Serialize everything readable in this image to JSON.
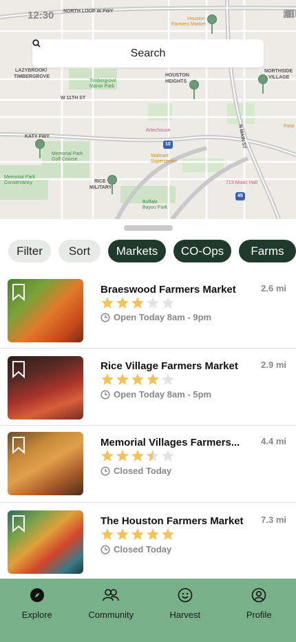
{
  "status": {
    "time": "12:30"
  },
  "map": {
    "labels": {
      "north_loop": "NORTH LOOP W FWY",
      "lazybrook": "LAZYBROOK/",
      "timbergrove": "TIMBERGROVE",
      "houston_heights_1": "HOUSTON",
      "houston_heights_2": "HEIGHTS",
      "northside_1": "NORTHSIDE",
      "northside_2": "VILLAGE",
      "w11th": "W 11TH ST",
      "katy": "KATY FWY",
      "rice_1": "RICE",
      "rice_2": "MILITARY",
      "n_main": "N MAIN ST"
    },
    "pois": {
      "houston_fm_1": "Houston",
      "houston_fm_2": "Farmers Market",
      "timbergrove_park_1": "Timbergrove",
      "timbergrove_park_2": "Manor Park",
      "artechouse": "Artechouse",
      "walmart_1": "Walmart",
      "walmart_2": "Supercenter",
      "memorial_golf_1": "Memorial Park",
      "memorial_golf_2": "Golf Course",
      "memorial_cons_1": "Memorial Park",
      "memorial_cons_2": "Conservancy",
      "music_hall": "713 Music Hall",
      "buffalo_1": "Buffalo",
      "buffalo_2": "Bayou Park",
      "fiesta": "Fiest"
    },
    "shields": {
      "i10": "10",
      "i45": "45"
    }
  },
  "search": {
    "label": "Search"
  },
  "chips": [
    {
      "label": "Filter",
      "style": "light"
    },
    {
      "label": "Sort",
      "style": "light"
    },
    {
      "label": "Markets",
      "style": "dark"
    },
    {
      "label": "CO-Ops",
      "style": "dark"
    },
    {
      "label": "Farms",
      "style": "dark"
    }
  ],
  "markets": [
    {
      "name": "Braeswood Farmers Market",
      "distance": "2.6 mi",
      "rating": 3,
      "hours": "Open Today 8am - 9pm"
    },
    {
      "name": "Rice Village Farmers Market",
      "distance": "2.9 mi",
      "rating": 4,
      "hours": "Open Today 8am - 5pm"
    },
    {
      "name": "Memorial Villages Farmers...",
      "distance": "4.4 mi",
      "rating": 3.5,
      "hours": "Closed Today"
    },
    {
      "name": "The Houston Farmers Market",
      "distance": "7.3 mi",
      "rating": 5,
      "hours": "Closed Today"
    }
  ],
  "nav": [
    {
      "label": "Explore",
      "icon": "compass-icon"
    },
    {
      "label": "Community",
      "icon": "people-icon"
    },
    {
      "label": "Harvest",
      "icon": "smiley-icon"
    },
    {
      "label": "Profile",
      "icon": "profile-icon"
    }
  ],
  "colors": {
    "accent_dark": "#1f3a2a",
    "nav_bg": "#78b089",
    "star": "#f3c35b",
    "star_empty": "#e3e3e3",
    "pin": "#6f9a7a"
  }
}
